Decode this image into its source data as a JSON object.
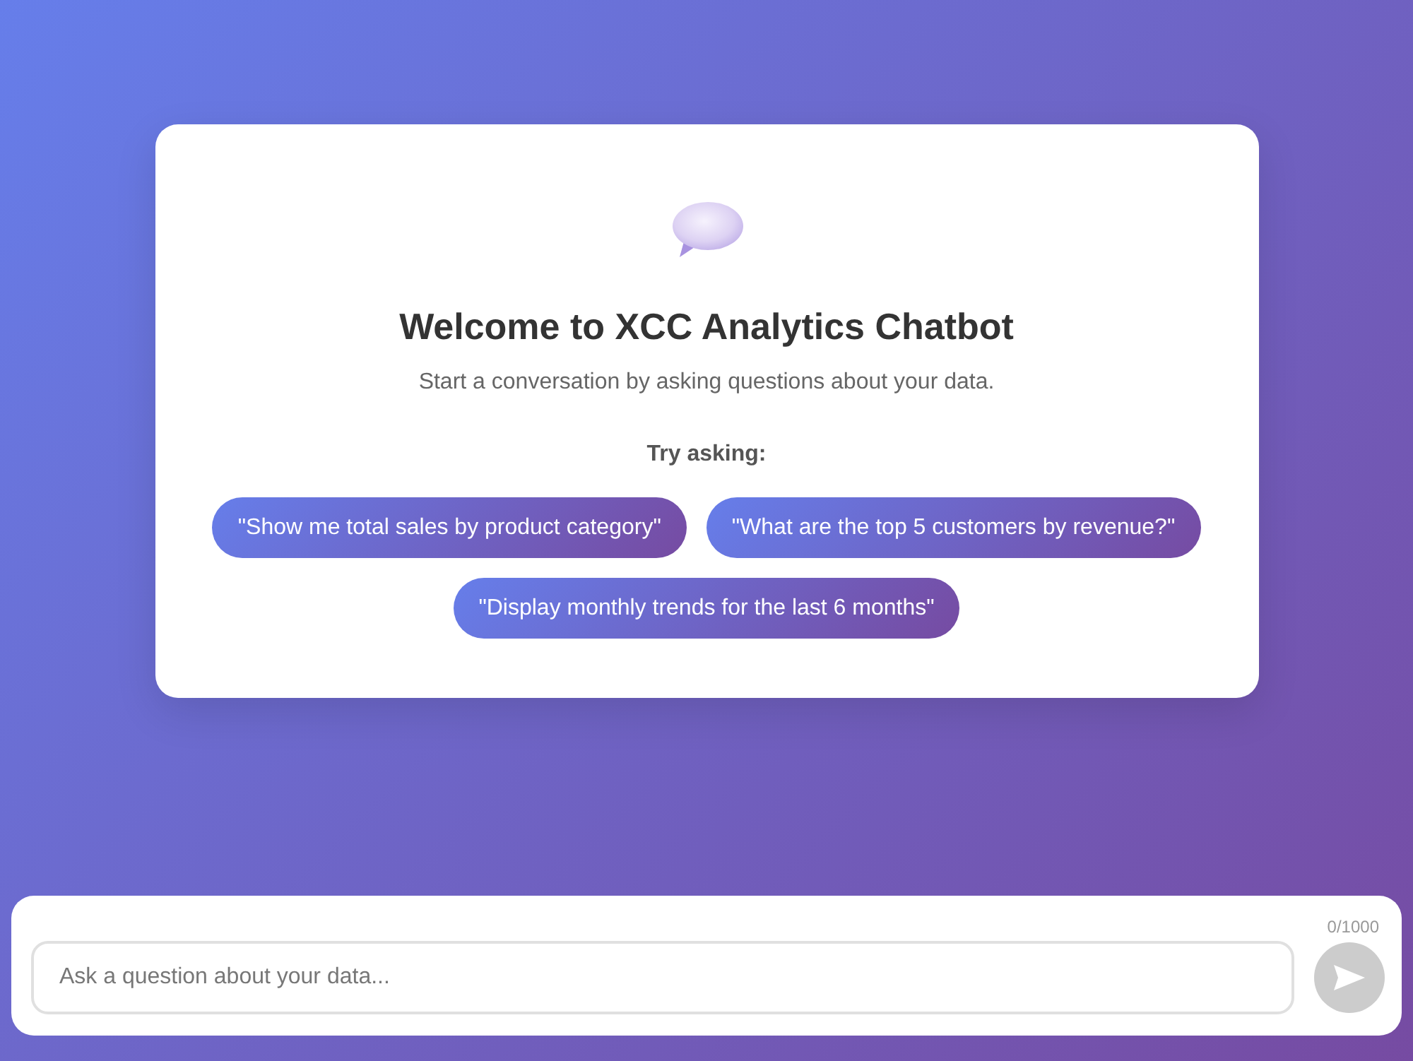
{
  "welcome": {
    "title": "Welcome to XCC Analytics Chatbot",
    "subtitle": "Start a conversation by asking questions about your data.",
    "prompt_heading": "Try asking:",
    "suggestions": [
      "\"Show me total sales by product category\"",
      "\"What are the top 5 customers by revenue?\"",
      "\"Display monthly trends for the last 6 months\""
    ]
  },
  "composer": {
    "counter": "0/1000",
    "input": {
      "placeholder": "Ask a question about your data..."
    },
    "send_button": {
      "disabled": true
    }
  }
}
